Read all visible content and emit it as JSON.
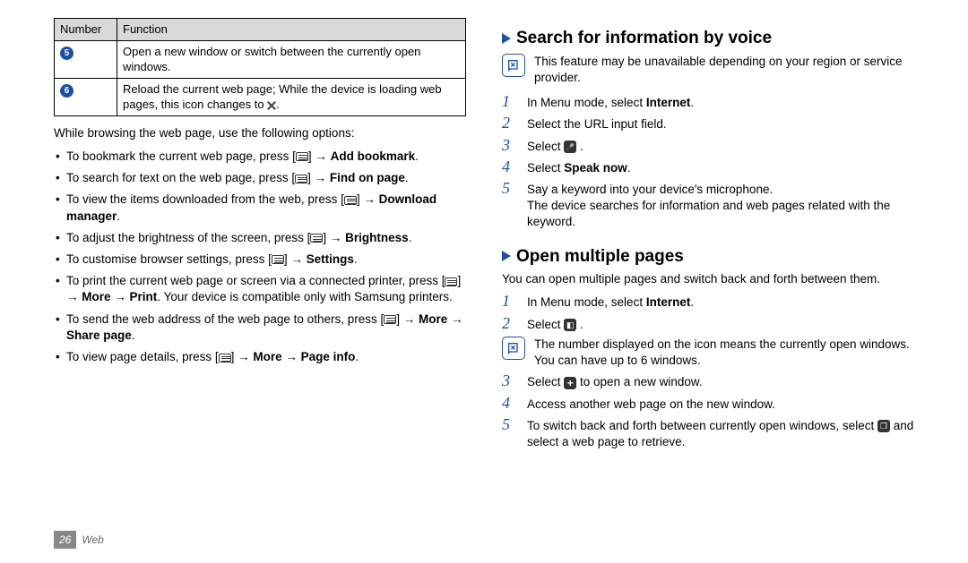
{
  "table": {
    "headers": {
      "c1": "Number",
      "c2": "Function"
    },
    "rows": [
      {
        "num": "5",
        "func": "Open a new window or switch between the currently open windows."
      },
      {
        "num": "6",
        "func_a": "Reload the current web page; While the device is loading web pages, this icon changes to ",
        "func_b": "."
      }
    ]
  },
  "intro": "While browsing the web page, use the following options:",
  "bullets": {
    "b1a": "To bookmark the current web page, press [",
    "b1b": "] → ",
    "b1c": "Add bookmark",
    "b1d": ".",
    "b2a": "To search for text on the web page, press [",
    "b2b": "] → ",
    "b2c": "Find on page",
    "b2d": ".",
    "b3a": "To view the items downloaded from the web, press [",
    "b3b": "] → ",
    "b3c": "Download manager",
    "b3d": ".",
    "b4a": "To adjust the brightness of the screen, press [",
    "b4b": "] → ",
    "b4c": "Brightness",
    "b4d": ".",
    "b5a": "To customise browser settings, press [",
    "b5b": "] → ",
    "b5c": "Settings",
    "b5d": ".",
    "b6a": "To print the current web page or screen via a connected printer, press [",
    "b6b": "] → ",
    "b6c": "More",
    "b6d": " → ",
    "b6e": "Print",
    "b6f": ". Your device is compatible only with Samsung printers.",
    "b7a": "To send the web address of the web page to others, press [",
    "b7b": "] → ",
    "b7c": "More",
    "b7d": " → ",
    "b7e": "Share page",
    "b7f": ".",
    "b8a": "To view page details, press [",
    "b8b": "] → ",
    "b8c": "More",
    "b8d": " → ",
    "b8e": "Page info",
    "b8f": "."
  },
  "sec1": {
    "title": "Search for information by voice",
    "note": "This feature may be unavailable depending on your region or service provider.",
    "s1a": "In Menu mode, select ",
    "s1b": "Internet",
    "s1c": ".",
    "s2": "Select the URL input field.",
    "s3a": "Select ",
    "s3b": " .",
    "s4a": "Select ",
    "s4b": "Speak now",
    "s4c": ".",
    "s5a": "Say a keyword into your device's microphone.",
    "s5b": "The device searches for information and web pages related with the keyword."
  },
  "sec2": {
    "title": "Open multiple pages",
    "lead": "You can open multiple pages and switch back and forth between them.",
    "s1a": "In Menu mode, select ",
    "s1b": "Internet",
    "s1c": ".",
    "s2a": "Select ",
    "s2b": " .",
    "note": "The number displayed on the icon means the currently open windows. You can have up to 6 windows.",
    "s3a": "Select ",
    "s3b": " to open a new window.",
    "s4": "Access another web page on the new window.",
    "s5a": "To switch back and forth between currently open windows, select ",
    "s5b": " and select a web page to retrieve."
  },
  "footer": {
    "page": "26",
    "label": "Web"
  }
}
